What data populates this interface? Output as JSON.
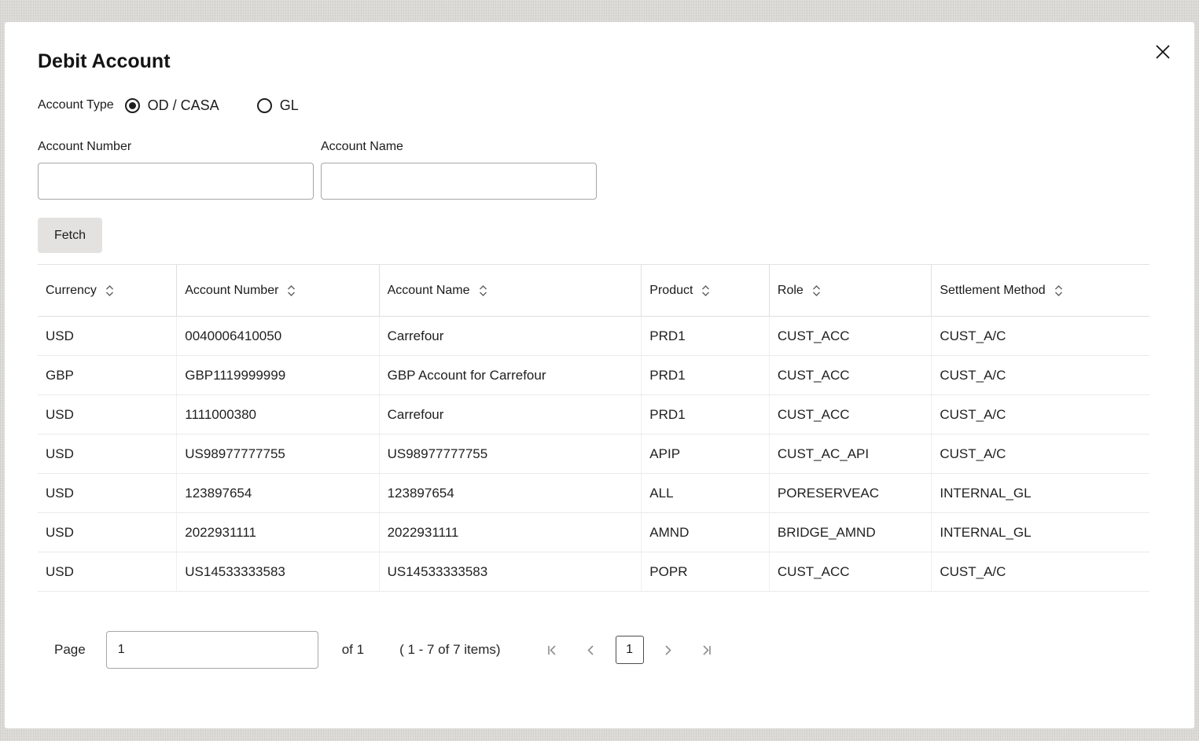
{
  "modal": {
    "title": "Debit Account"
  },
  "form": {
    "account_type_label": "Account Type",
    "radio_options": [
      {
        "label": "OD / CASA",
        "selected": true
      },
      {
        "label": "GL",
        "selected": false
      }
    ],
    "account_number": {
      "label": "Account Number",
      "value": ""
    },
    "account_name": {
      "label": "Account Name",
      "value": ""
    },
    "fetch_label": "Fetch"
  },
  "table": {
    "columns": [
      "Currency",
      "Account Number",
      "Account Name",
      "Product",
      "Role",
      "Settlement Method"
    ],
    "rows": [
      [
        "USD",
        "0040006410050",
        "Carrefour",
        "PRD1",
        "CUST_ACC",
        "CUST_A/C"
      ],
      [
        "GBP",
        "GBP1119999999",
        "GBP Account for Carrefour",
        "PRD1",
        "CUST_ACC",
        "CUST_A/C"
      ],
      [
        "USD",
        "1111000380",
        "Carrefour",
        "PRD1",
        "CUST_ACC",
        "CUST_A/C"
      ],
      [
        "USD",
        "US98977777755",
        "US98977777755",
        "APIP",
        "CUST_AC_API",
        "CUST_A/C"
      ],
      [
        "USD",
        "123897654",
        "123897654",
        "ALL",
        "PORESERVEAC",
        "INTERNAL_GL"
      ],
      [
        "USD",
        "2022931111",
        "2022931111",
        "AMND",
        "BRIDGE_AMND",
        "INTERNAL_GL"
      ],
      [
        "USD",
        "US14533333583",
        "US14533333583",
        "POPR",
        "CUST_ACC",
        "CUST_A/C"
      ]
    ]
  },
  "pagination": {
    "page_label": "Page",
    "page_value": "1",
    "of_text": "of 1",
    "items_text": "( 1 - 7 of 7 items)",
    "current_page": "1"
  }
}
